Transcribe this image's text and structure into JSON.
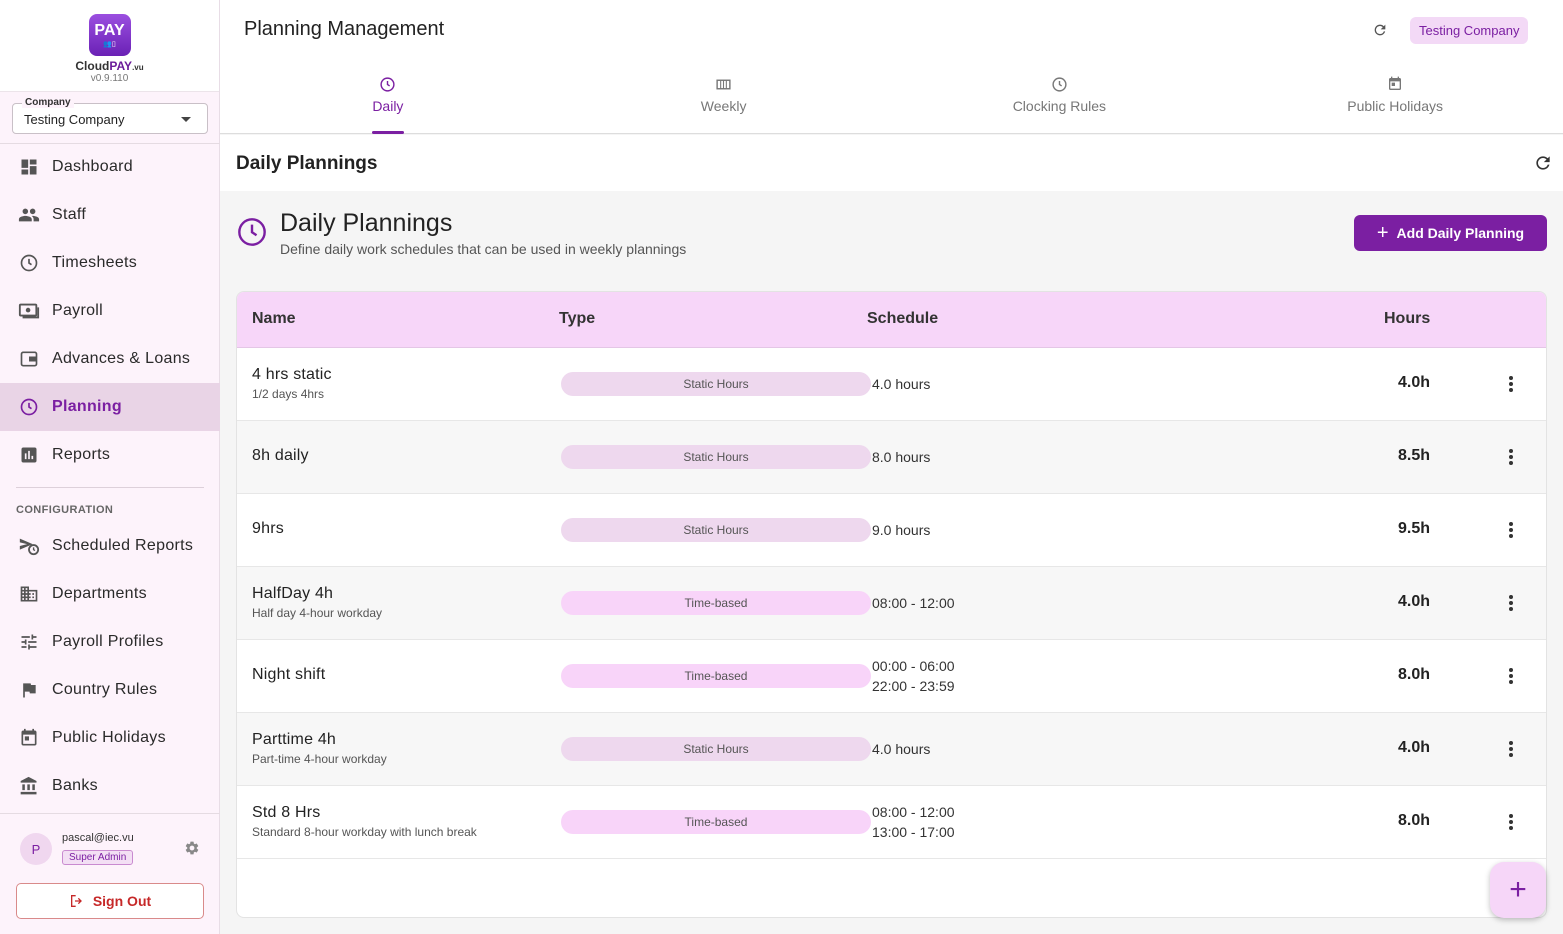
{
  "app": {
    "logo_text": "PAY",
    "brand_prefix": "Cloud",
    "brand_accent": "PAY",
    "brand_suffix": ".vu",
    "version": "v0.9.110",
    "accent_color": "#7b1fa2"
  },
  "company_select": {
    "label": "Company",
    "value": "Testing Company"
  },
  "nav": {
    "items": [
      {
        "label": "Dashboard",
        "icon": "dashboard-icon"
      },
      {
        "label": "Staff",
        "icon": "people-icon"
      },
      {
        "label": "Timesheets",
        "icon": "clock-icon"
      },
      {
        "label": "Payroll",
        "icon": "money-icon"
      },
      {
        "label": "Advances & Loans",
        "icon": "wallet-icon"
      },
      {
        "label": "Planning",
        "icon": "clock-icon",
        "active": true
      },
      {
        "label": "Reports",
        "icon": "bar-chart-icon"
      }
    ],
    "section_label": "CONFIGURATION",
    "config_items": [
      {
        "label": "Scheduled Reports",
        "icon": "scheduled-send-icon"
      },
      {
        "label": "Departments",
        "icon": "building-icon"
      },
      {
        "label": "Payroll Profiles",
        "icon": "tune-icon"
      },
      {
        "label": "Country Rules",
        "icon": "flag-icon"
      },
      {
        "label": "Public Holidays",
        "icon": "calendar-icon"
      },
      {
        "label": "Banks",
        "icon": "bank-icon"
      }
    ]
  },
  "user": {
    "initial": "P",
    "email": "pascal@iec.vu",
    "role": "Super Admin",
    "sign_out": "Sign Out"
  },
  "header": {
    "title": "Planning Management",
    "company_chip": "Testing Company"
  },
  "tabs": [
    {
      "label": "Daily",
      "active": true
    },
    {
      "label": "Weekly"
    },
    {
      "label": "Clocking Rules"
    },
    {
      "label": "Public Holidays"
    }
  ],
  "section": {
    "title": "Daily Plannings"
  },
  "content": {
    "title": "Daily Plannings",
    "subtitle": "Define daily work schedules that can be used in weekly plannings",
    "add_button": "Add Daily Planning"
  },
  "table": {
    "columns": [
      "Name",
      "Type",
      "Schedule",
      "Hours"
    ],
    "rows": [
      {
        "name": "4 hrs static",
        "description": "1/2 days 4hrs",
        "type": "Static Hours",
        "schedule": [
          "4.0 hours"
        ],
        "hours": "4.0h"
      },
      {
        "name": "8h daily",
        "description": "",
        "type": "Static Hours",
        "schedule": [
          "8.0 hours"
        ],
        "hours": "8.5h"
      },
      {
        "name": "9hrs",
        "description": "",
        "type": "Static Hours",
        "schedule": [
          "9.0 hours"
        ],
        "hours": "9.5h"
      },
      {
        "name": "HalfDay 4h",
        "description": "Half day 4-hour workday",
        "type": "Time-based",
        "schedule": [
          "08:00 - 12:00"
        ],
        "hours": "4.0h"
      },
      {
        "name": "Night shift",
        "description": "",
        "type": "Time-based",
        "schedule": [
          "00:00 - 06:00",
          "22:00 - 23:59"
        ],
        "hours": "8.0h"
      },
      {
        "name": "Parttime 4h",
        "description": "Part-time 4-hour workday",
        "type": "Static Hours",
        "schedule": [
          "4.0 hours"
        ],
        "hours": "4.0h"
      },
      {
        "name": "Std 8 Hrs",
        "description": "Standard 8-hour workday with lunch break",
        "type": "Time-based",
        "schedule": [
          "08:00 - 12:00",
          "13:00 - 17:00"
        ],
        "hours": "8.0h"
      }
    ]
  }
}
